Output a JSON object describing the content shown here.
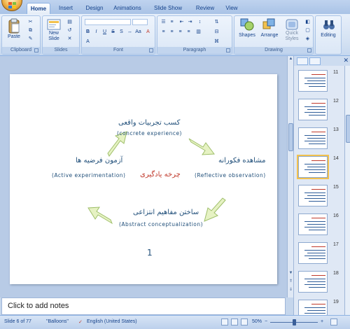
{
  "ribbon": {
    "tabs": [
      "Home",
      "Insert",
      "Design",
      "Animations",
      "Slide Show",
      "Review",
      "View"
    ],
    "active_tab": "Home",
    "groups": {
      "clipboard": {
        "label": "Clipboard",
        "paste": "Paste"
      },
      "slides": {
        "label": "Slides",
        "new_slide_line1": "New",
        "new_slide_line2": "Slide"
      },
      "font": {
        "label": "Font"
      },
      "paragraph": {
        "label": "Paragraph"
      },
      "drawing": {
        "label": "Drawing",
        "shapes": "Shapes",
        "arrange": "Arrange",
        "quick_styles_line1": "Quick",
        "quick_styles_line2": "Styles"
      },
      "editing": {
        "label": "Editing"
      }
    }
  },
  "slide": {
    "top_fa": "کسب تجربیات واقعی",
    "top_en": "(concrete experience)",
    "right_fa": "مشاهده فکورانه",
    "right_en": "(Reflective observation)",
    "left_fa": "آزمون فرضیه ها",
    "left_en": "(Active experimentation)",
    "bottom_fa": "ساختن مفاهیم انتزاعی",
    "bottom_en": "(Abstract conceptualization)",
    "center": "چرخه یادگیری",
    "page_number": "1",
    "arrow_colors": {
      "fill": "#e6f2c3",
      "stroke": "#9fbf6a"
    }
  },
  "notes": {
    "placeholder": "Click to add notes"
  },
  "thumbnails": {
    "numbers": [
      "11",
      "12",
      "13",
      "14",
      "15",
      "16",
      "17",
      "18",
      "19"
    ],
    "selected": "14"
  },
  "status_bar": {
    "slide_info": "Slide 6 of 77",
    "theme": "\"Balloons\"",
    "language": "English (United States)",
    "zoom": "50%"
  },
  "colors": {
    "accent": "#15428b",
    "ribbon": "#d3e1f3",
    "workarea": "#b8cbe6"
  }
}
